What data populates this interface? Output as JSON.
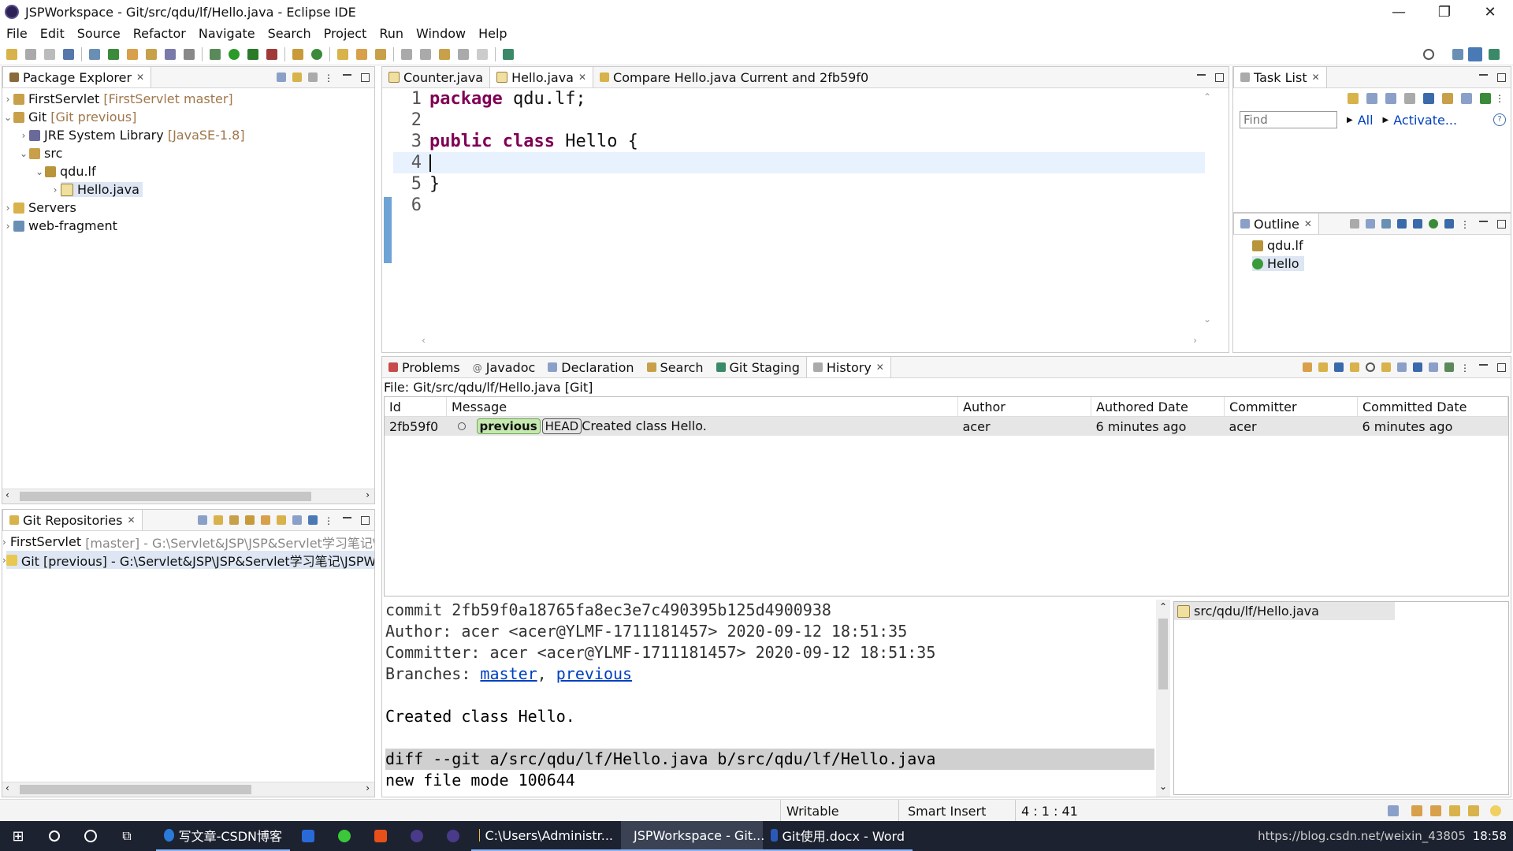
{
  "window": {
    "title": "JSPWorkspace - Git/src/qdu/lf/Hello.java - Eclipse IDE",
    "minimize": "—",
    "maximize": "❐",
    "close": "✕"
  },
  "menu": [
    "File",
    "Edit",
    "Source",
    "Refactor",
    "Navigate",
    "Search",
    "Project",
    "Run",
    "Window",
    "Help"
  ],
  "package_explorer": {
    "tab": "Package Explorer",
    "items": [
      {
        "label": "FirstServlet",
        "extra": "[FirstServlet master]"
      },
      {
        "label": "Git",
        "extra": "[Git previous]"
      },
      {
        "label": "JRE System Library",
        "extra": "[JavaSE-1.8]"
      },
      {
        "label": "src",
        "extra": ""
      },
      {
        "label": "qdu.lf",
        "extra": ""
      },
      {
        "label": "Hello.java",
        "extra": ""
      },
      {
        "label": "Servers",
        "extra": ""
      },
      {
        "label": "web-fragment",
        "extra": ""
      }
    ]
  },
  "git_repositories": {
    "tab": "Git Repositories",
    "items": [
      {
        "label": "FirstServlet",
        "extra": "[master] - G:\\Servlet&JSP\\JSP&Servlet学习笔记\\"
      },
      {
        "label": "Git [previous] - G:\\Servlet&JSP\\JSP&Servlet学习笔记\\JSPWo",
        "extra": ""
      }
    ]
  },
  "editor": {
    "tabs": [
      "Counter.java",
      "Hello.java",
      "Compare Hello.java Current and 2fb59f0"
    ],
    "lines": [
      {
        "no": "1",
        "text": "package qdu.lf;"
      },
      {
        "no": "2",
        "text": ""
      },
      {
        "no": "3",
        "text": "public class Hello {"
      },
      {
        "no": "4",
        "text": ""
      },
      {
        "no": "5",
        "text": "}"
      },
      {
        "no": "6",
        "text": ""
      }
    ],
    "kw_package": "package",
    "pkg_rest": " qdu.lf;",
    "kw_public": "public",
    "kw_class": "class",
    "class_rest": " Hello {",
    "closing": "}"
  },
  "task_list": {
    "tab": "Task List",
    "find_placeholder": "Find",
    "all": "All",
    "activate": "Activate..."
  },
  "outline": {
    "tab": "Outline",
    "items": [
      "qdu.lf",
      "Hello"
    ]
  },
  "bottom": {
    "tabs": [
      "Problems",
      "Javadoc",
      "Declaration",
      "Search",
      "Git Staging",
      "History"
    ],
    "file_label": "File: Git/src/qdu/lf/Hello.java [Git]",
    "columns": [
      "Id",
      "Message",
      "Author",
      "Authored Date",
      "Committer",
      "Committed Date"
    ],
    "row": {
      "id": "2fb59f0",
      "badge1": "previous",
      "badge2": "HEAD",
      "message": "Created class Hello.",
      "author": "acer",
      "authored": "6 minutes ago",
      "committer": "acer",
      "committed": "6 minutes ago"
    },
    "commit_lines": {
      "commit": "commit 2fb59f0a18765fa8ec3e7c490395b125d4900938",
      "author": "Author: acer <acer@YLMF-1711181457> 2020-09-12 18:51:35",
      "committer": "Committer: acer <acer@YLMF-1711181457> 2020-09-12 18:51:35",
      "branches_label": "Branches: ",
      "branch1": "master",
      "sep": ", ",
      "branch2": "previous",
      "message": "Created class Hello.",
      "diff": "diff --git a/src/qdu/lf/Hello.java b/src/qdu/lf/Hello.java",
      "mode": "new file mode 100644"
    },
    "file_item": "src/qdu/lf/Hello.java"
  },
  "status": {
    "writable": "Writable",
    "insert": "Smart Insert",
    "position": "4 : 1 : 41"
  },
  "taskbar": {
    "apps": [
      "写文章-CSDN博客",
      "C:\\Users\\Administr...",
      "JSPWorkspace - Git...",
      "Git使用.docx - Word"
    ],
    "tray_text": "https://blog.csdn.net/weixin_43805",
    "time": "18:58"
  },
  "colors": {
    "keyword": "#7f0055",
    "link": "#0040c0",
    "badge_green": "#c6e8b0",
    "taskbar": "#1c2230"
  }
}
